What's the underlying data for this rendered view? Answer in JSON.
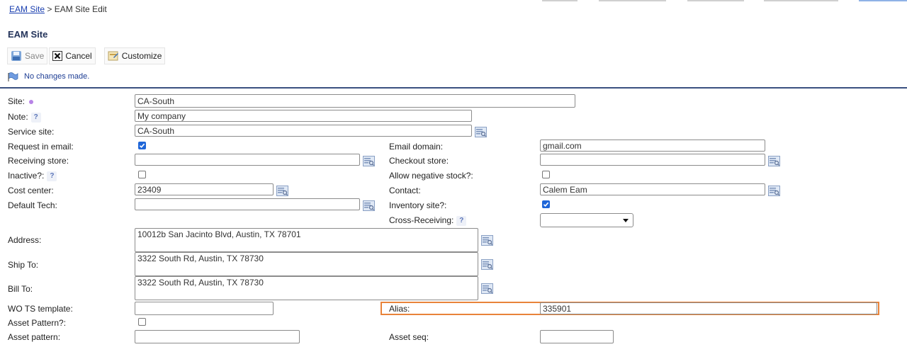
{
  "breadcrumb": {
    "link": "EAM Site",
    "sep": ">",
    "current": "EAM Site Edit"
  },
  "page_title": "EAM Site",
  "toolbar": {
    "save": "Save",
    "cancel": "Cancel",
    "customize": "Customize"
  },
  "status_message": "No changes made.",
  "form": {
    "site": {
      "label": "Site:",
      "value": "CA-South"
    },
    "note": {
      "label": "Note:",
      "value": "My company"
    },
    "service_site": {
      "label": "Service site:",
      "value": "CA-South"
    },
    "request_in_email": {
      "label": "Request in email:",
      "checked": true
    },
    "email_domain": {
      "label": "Email domain:",
      "value": "gmail.com"
    },
    "receiving_store": {
      "label": "Receiving store:",
      "value": ""
    },
    "checkout_store": {
      "label": "Checkout store:",
      "value": ""
    },
    "inactive": {
      "label": "Inactive?:",
      "checked": false
    },
    "allow_negative_stock": {
      "label": "Allow negative stock?:",
      "checked": false
    },
    "cost_center": {
      "label": "Cost center:",
      "value": "23409"
    },
    "contact": {
      "label": "Contact:",
      "value": "Calem Eam"
    },
    "default_tech": {
      "label": "Default Tech:",
      "value": ""
    },
    "inventory_site": {
      "label": "Inventory site?:",
      "checked": true
    },
    "cross_receiving": {
      "label": "Cross-Receiving:",
      "value": ""
    },
    "address": {
      "label": "Address:",
      "value": "10012b San Jacinto Blvd, Austin, TX 78701"
    },
    "ship_to": {
      "label": "Ship To:",
      "value": "3322 South Rd, Austin, TX 78730"
    },
    "bill_to": {
      "label": "Bill To:",
      "value": "3322 South Rd, Austin, TX 78730"
    },
    "wo_ts_template": {
      "label": "WO TS template:",
      "value": ""
    },
    "alias": {
      "label": "Alias:",
      "value": "335901"
    },
    "asset_pattern_flag": {
      "label": "Asset Pattern?:",
      "checked": false
    },
    "asset_pattern": {
      "label": "Asset pattern:",
      "value": ""
    },
    "asset_seq": {
      "label": "Asset seq:",
      "value": ""
    }
  },
  "help_glyph": "?",
  "colors": {
    "accent": "#1f66d8",
    "highlight": "#e8833a",
    "separator": "#3a5080"
  }
}
